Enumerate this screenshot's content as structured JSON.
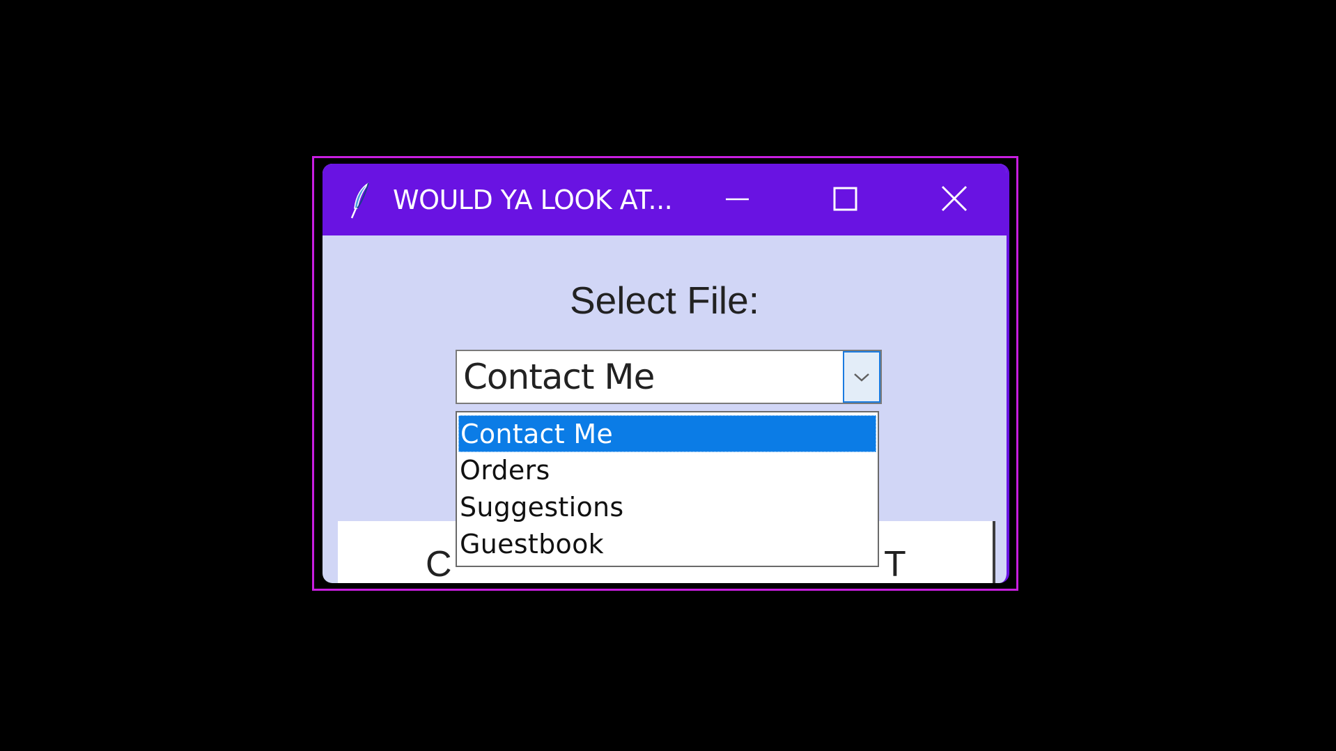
{
  "window": {
    "title": "WOULD YA LOOK AT...",
    "minimize_icon": "minimize-icon",
    "maximize_icon": "maximize-icon",
    "close_icon": "close-icon",
    "app_icon": "feather-icon"
  },
  "colors": {
    "titlebar": "#6913e2",
    "frame_highlight": "#c81ee0",
    "window_bg": "#d1d6f6",
    "selection": "#0b7ce6"
  },
  "form": {
    "label": "Select File:",
    "combobox": {
      "value": "Contact Me",
      "arrow_icon": "chevron-down-icon",
      "options": [
        "Contact Me",
        "Orders",
        "Suggestions",
        "Guestbook"
      ],
      "highlighted_option": "Contact Me"
    },
    "action_button": {
      "visible_left": "C",
      "visible_right": "T"
    }
  }
}
